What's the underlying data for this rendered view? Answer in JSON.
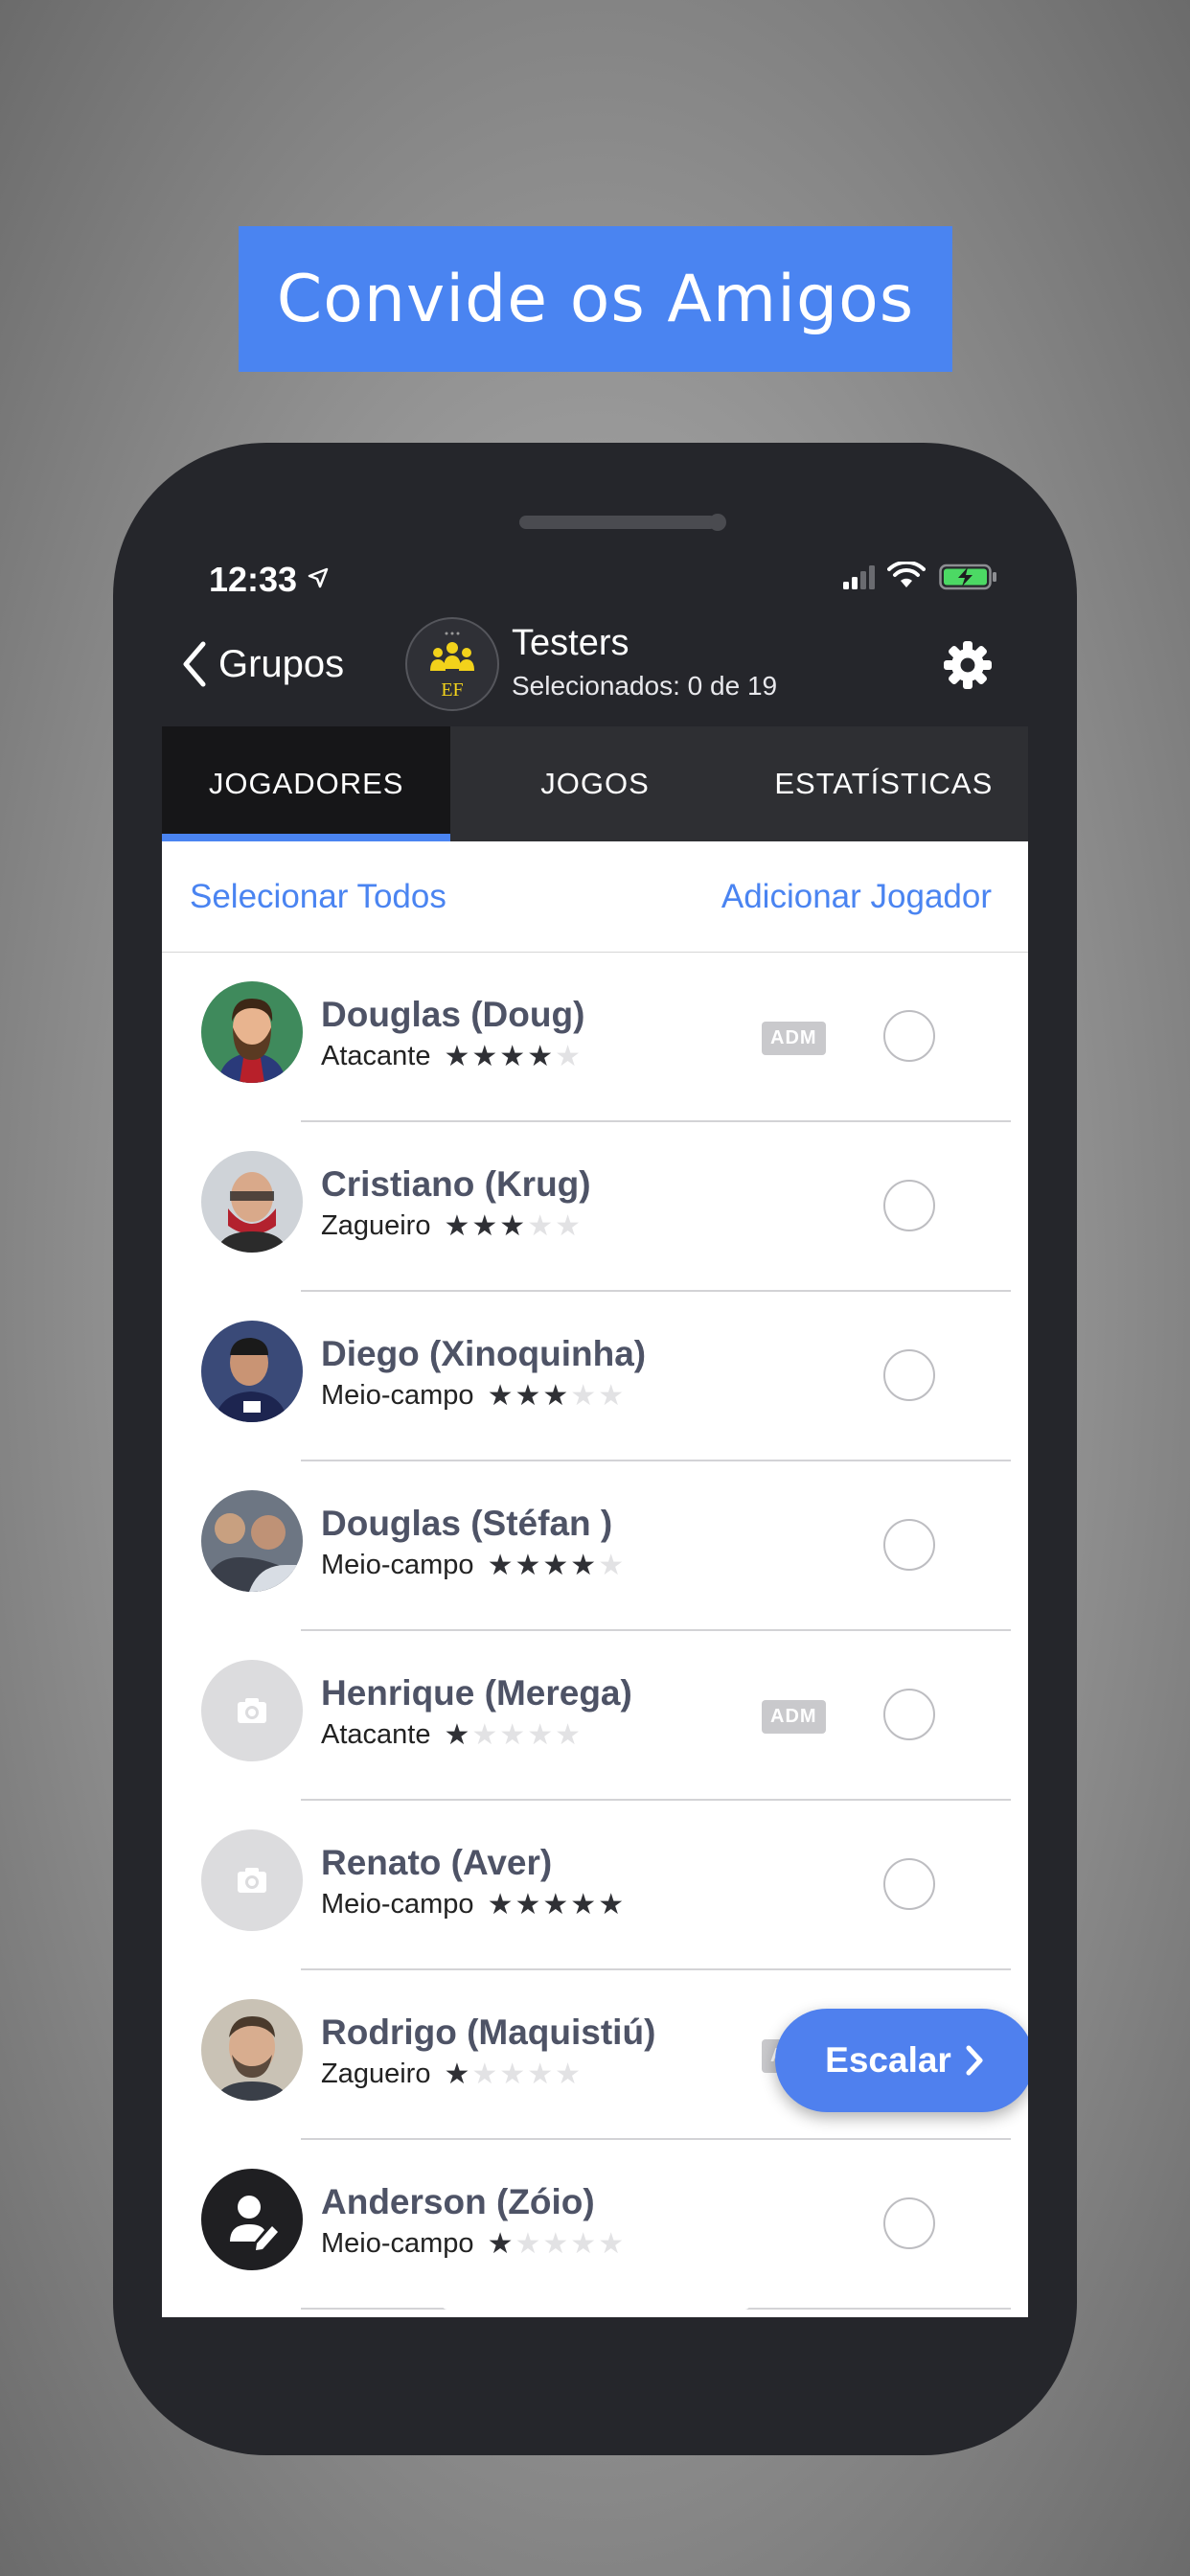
{
  "banner": {
    "text": "Convide os Amigos"
  },
  "status_bar": {
    "time": "12:33"
  },
  "nav": {
    "back_label": "Grupos",
    "group_title": "Testers",
    "group_subtitle": "Selecionados: 0 de 19",
    "logo_text": "EF"
  },
  "tabs": [
    {
      "label": "JOGADORES",
      "active": true
    },
    {
      "label": "JOGOS",
      "active": false
    },
    {
      "label": "ESTATÍSTICAS",
      "active": false
    }
  ],
  "actions": {
    "select_all": "Selecionar Todos",
    "add_player": "Adicionar Jogador"
  },
  "players": [
    {
      "name": "Douglas (Doug)",
      "position": "Atacante",
      "stars": 4,
      "adm": true,
      "avatar": "illustration"
    },
    {
      "name": "Cristiano (Krug)",
      "position": "Zagueiro",
      "stars": 3,
      "adm": false,
      "avatar": "photo"
    },
    {
      "name": "Diego (Xinoquinha)",
      "position": "Meio-campo",
      "stars": 3,
      "adm": false,
      "avatar": "photo"
    },
    {
      "name": "Douglas (Stéfan )",
      "position": "Meio-campo",
      "stars": 4,
      "adm": false,
      "avatar": "photo"
    },
    {
      "name": "Henrique (Merega)",
      "position": "Atacante",
      "stars": 1,
      "adm": true,
      "avatar": "camera"
    },
    {
      "name": "Renato (Aver)",
      "position": "Meio-campo",
      "stars": 5,
      "adm": false,
      "avatar": "camera"
    },
    {
      "name": "Rodrigo (Maquistiú)",
      "position": "Zagueiro",
      "stars": 1,
      "adm": true,
      "avatar": "photo"
    },
    {
      "name": "Anderson (Zóio)",
      "position": "Meio-campo",
      "stars": 1,
      "adm": false,
      "avatar": "edit-user"
    }
  ],
  "adm_label": "ADM",
  "fab": {
    "label": "Escalar"
  },
  "colors": {
    "accent": "#4a84f1",
    "banner": "#4a84f1",
    "phone": "#25262b"
  }
}
